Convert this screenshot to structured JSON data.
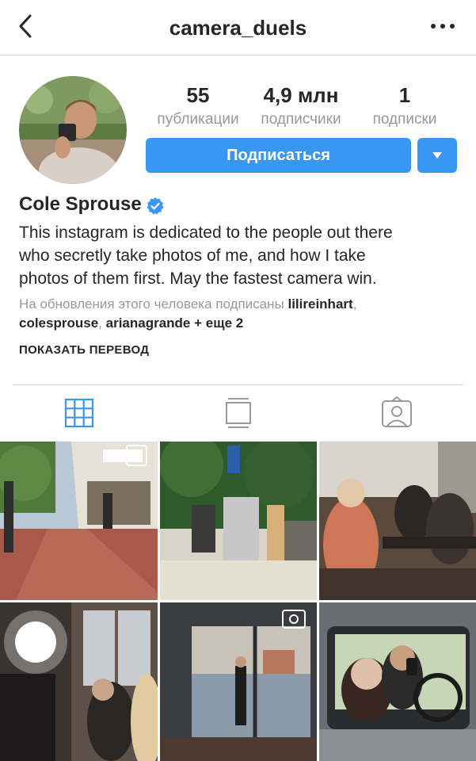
{
  "header": {
    "username": "camera_duels"
  },
  "profile": {
    "stats": [
      {
        "value": "55",
        "label": "публикации"
      },
      {
        "value": "4,9 млн",
        "label": "подписчики"
      },
      {
        "value": "1",
        "label": "подписки"
      }
    ],
    "follow_label": "Подписаться",
    "name": "Cole Sprouse",
    "bio_lines": [
      "This instagram is dedicated to the people out there",
      "who secretly take photos of me, and how I take",
      "photos of them first. May the fastest camera win."
    ],
    "followed_by": {
      "prefix": "На обновления этого человека подписаны",
      "user1": "lilireinhart",
      "sep1": ",",
      "user2": "colesprouse",
      "sep2": ",",
      "user3": "arianagrande",
      "suffix": "+ еще 2"
    },
    "translate_label": "ПОКАЗАТЬ ПЕРЕВОД"
  },
  "colors": {
    "accent": "#3897f0",
    "secondary_text": "#999999",
    "text": "#262626",
    "divider": "#dbdbdb"
  },
  "icons": {
    "back": "chevron-left-icon",
    "more": "more-horizontal-icon",
    "verified": "verified-badge-icon",
    "dropdown": "triangle-down-icon",
    "tabs": [
      "grid-icon",
      "feed-icon",
      "tagged-icon"
    ]
  },
  "posts": [
    {
      "description": "street with brick sidewalk and storefronts",
      "multi": true
    },
    {
      "description": "people standing by a lakeside wall",
      "multi": false
    },
    {
      "description": "woman photographing at a cafe table",
      "multi": false
    },
    {
      "description": "dark room with bright window and woman",
      "multi": false
    },
    {
      "description": "person photographing through glass doors",
      "multi": false,
      "video": true
    },
    {
      "description": "woman photographing from a car",
      "multi": false
    }
  ]
}
